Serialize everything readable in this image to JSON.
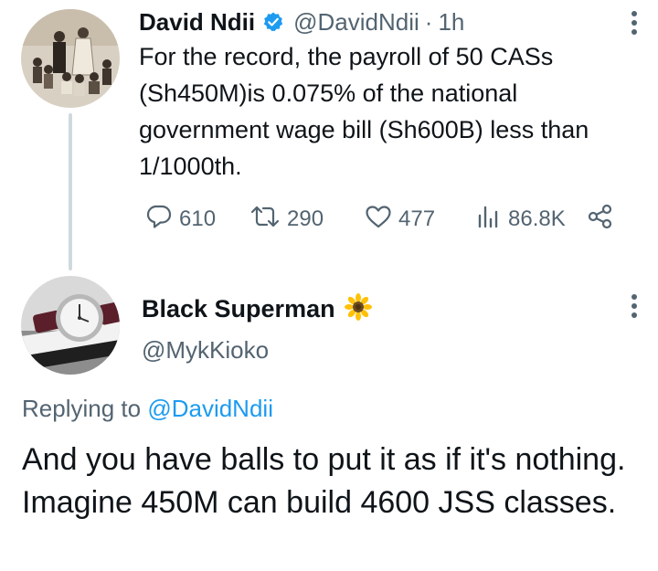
{
  "tweet": {
    "author_name": "David Ndii",
    "author_handle": "@DavidNdii",
    "separator": "·",
    "time": "1h",
    "text": "For the record, the payroll of 50 CASs (Sh450M)is 0.075% of the national government wage bill (Sh600B) less than 1/1000th.",
    "stats": {
      "replies": "610",
      "reposts": "290",
      "likes": "477",
      "views": "86.8K"
    }
  },
  "reply": {
    "author_name": "Black Superman",
    "author_handle": "@MykKioko",
    "replying_label": "Replying to",
    "replying_handle": "@DavidNdii",
    "text": "And you have balls to put it as if it's nothing. Imagine 450M can build 4600 JSS classes."
  },
  "colors": {
    "accent": "#1d9bf0",
    "secondary_text": "#536471",
    "primary_text": "#0f1419",
    "thread_line": "#cfd9de"
  },
  "icons": [
    "verified-badge-icon",
    "more-icon",
    "reply-icon",
    "repost-icon",
    "like-icon",
    "views-icon",
    "share-icon",
    "sunflower-emoji-icon"
  ]
}
